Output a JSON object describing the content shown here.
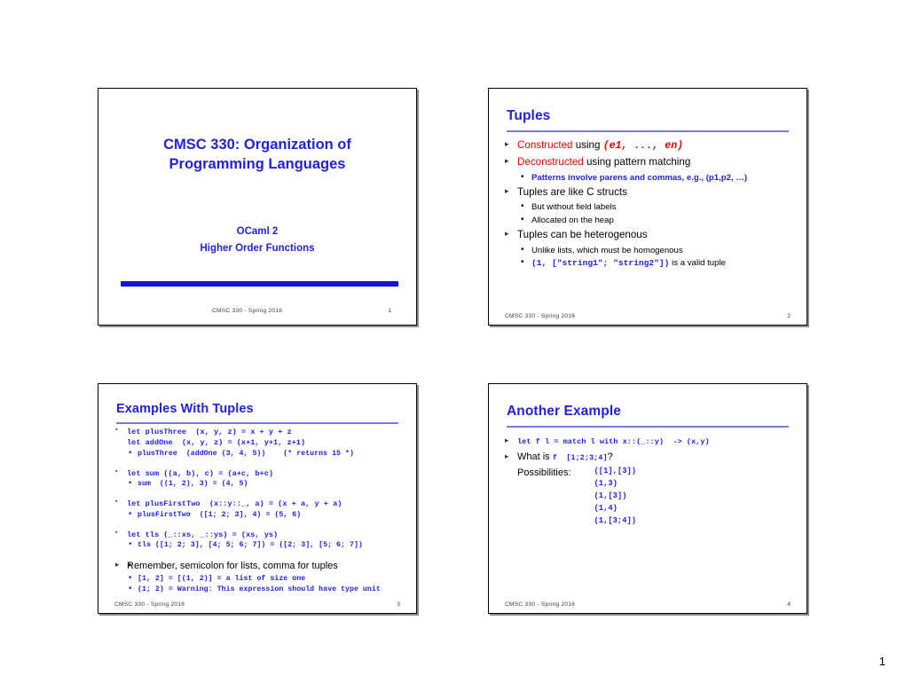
{
  "document": {
    "page_number": "1"
  },
  "slides": [
    {
      "id": "slide-1",
      "kind": "title",
      "title_line_1": "CMSC 330: Organization of",
      "title_line_2": "Programming Languages",
      "subtitle_line_1": "OCaml 2",
      "subtitle_line_2": "Higher Order Functions",
      "footer": "CMSC  330 - Spring  2016",
      "number": "1"
    },
    {
      "id": "slide-2",
      "kind": "content",
      "title": "Tuples",
      "bullets": {
        "b1_red": "Constructed",
        "b1_rest": " using ",
        "b1_code": "(e1,  ...,  en)",
        "b2_red": "Deconstructed",
        "b2_rest": " using pattern matching",
        "b2_sub": "Patterns involve parens and commas, e.g., (p1,p2, …)",
        "b3": "Tuples are like C structs",
        "b3_sub_1": "But without field labels",
        "b3_sub_2": "Allocated on the heap",
        "b4": "Tuples can be heterogenous",
        "b4_sub_1": "Unlike lists, which must be homogenous",
        "b4_sub_2_code": "(1,  [\"string1\";  \"string2\"])",
        "b4_sub_2_rest": "  is a valid tuple"
      },
      "footer": "CMSC 330 -  Spring 2016",
      "number": "2"
    },
    {
      "id": "slide-3",
      "kind": "code",
      "title": "Examples With Tuples",
      "group_1": {
        "line_1": "let plusThree  (x, y, z) = x + y + z",
        "line_2": "let addOne  (x, y, z) = (x+1, y+1, z+1)",
        "sub_1": "plusThree  (addOne (3, 4, 5))    (* returns 15 *)"
      },
      "group_2": {
        "line_1": "let sum ((a, b), c) = (a+c, b+c)",
        "sub_1": "sum  ((1, 2), 3) = (4, 5)"
      },
      "group_3": {
        "line_1": "let plusFirstTwo  (x::y::_, a) = (x + a, y + a)",
        "sub_1": "plusFirstTwo  ([1; 2; 3], 4) = (5, 6)"
      },
      "group_4": {
        "line_1": "let tls (_::xs, _::ys) = (xs, ys)",
        "sub_1": "tls ([1; 2; 3], [4; 5; 6; 7]) = ([2; 3], [5; 6; 7])"
      },
      "group_5": {
        "line_1": "Remember, semicolon for lists, comma for tuples",
        "sub_1": "[1, 2] = [(1, 2)] = a list of size one",
        "sub_2": "(1; 2) = Warning: This expression should have type unit"
      },
      "footer": "CMSC 330 - Spring 2016",
      "number": "3"
    },
    {
      "id": "slide-4",
      "kind": "code",
      "title": "Another Example",
      "line_1": "let f l = match l with x::(_::y)  -> (x,y)",
      "line_2_prefix": "What is ",
      "line_2_code": "f  [1;2;3;4]",
      "line_2_suffix": "?",
      "possibilities_label": "Possibilities:",
      "possibilities": [
        "([1],[3])",
        "(1,3)",
        "(1,[3])",
        "(1,4)",
        "(1,[3;4])"
      ],
      "footer": "CMSC 330 -  Spring 2016",
      "number": "4"
    }
  ],
  "colors": {
    "title_blue": "#2222dd",
    "rule_blue": "#1111ee",
    "underline_periwinkle": "#7b7bdf",
    "accent_red": "#e60000",
    "code_blue": "#2222dd",
    "footer_gray": "#3a3a3a"
  }
}
